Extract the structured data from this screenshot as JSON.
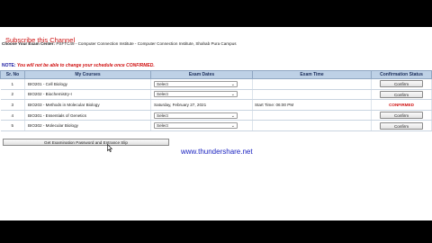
{
  "overlay": {
    "subscribe": "Subscribe this Channel",
    "watermark": "www.thundershare.net"
  },
  "header": {
    "center_label": "Choose Your Exam Center:",
    "center_value": "PSFTC49 - Computer Connection Institute - Computer Connection Institute, Shahab Pura Campus"
  },
  "note": {
    "label": "NOTE:",
    "text": "You will not be able to change your schedule once CONFIRMED."
  },
  "table": {
    "headers": [
      "Sr. No",
      "My Courses",
      "Exam Dates",
      "Exam Time",
      "Confirmation Status"
    ],
    "rows": [
      {
        "sr": "1",
        "course": "BIO201 - Cell Biology",
        "date": "Select",
        "time": "",
        "status": "Confirm"
      },
      {
        "sr": "2",
        "course": "BIO202 - Biochemistry-I",
        "date": "Select",
        "time": "",
        "status": "Confirm"
      },
      {
        "sr": "3",
        "course": "BIO203 - Methods in Molecular Biology",
        "date": "Saturday, February 27, 2021",
        "time": "Start Time: 06:00 PM",
        "status": "CONFIRMED"
      },
      {
        "sr": "4",
        "course": "BIO301 - Essentials of Genetics",
        "date": "Select",
        "time": "",
        "status": "Confirm"
      },
      {
        "sr": "5",
        "course": "BIO302 - Molecular Biology",
        "date": "Select",
        "time": "",
        "status": "Confirm"
      }
    ]
  },
  "slip_button": "Get Examination Password and Entrance Slip",
  "colors": {
    "header_bg": "#bed1e6",
    "confirmed": "#d01010",
    "watermark": "#1a22c0",
    "subscribe": "#cc1111"
  }
}
